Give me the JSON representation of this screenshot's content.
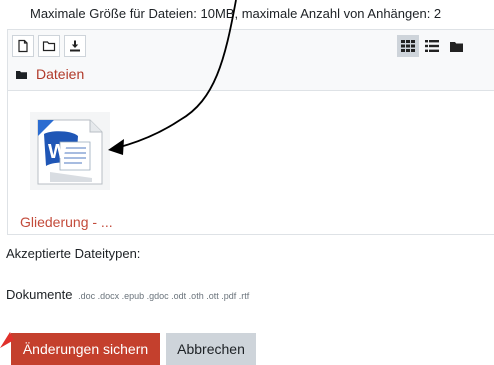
{
  "size_info": "Maximale Größe für Dateien: 10MB, maximale Anzahl von Anhängen: 2",
  "filemanager": {
    "toolbar": {
      "left_icons": [
        "add-file-icon",
        "create-folder-icon",
        "download-icon"
      ],
      "view_icons": [
        "grid-view-icon",
        "list-view-icon",
        "tree-view-icon"
      ],
      "active_view": "grid-view-icon"
    },
    "breadcrumb": {
      "folder": "Dateien"
    },
    "files": [
      {
        "name": "Gliederung - ...",
        "icon": "word-document-icon"
      }
    ]
  },
  "accepted": {
    "label": "Akzeptierte Dateitypen:",
    "category": "Dokumente",
    "extensions": ".doc .docx .epub .gdoc .odt .oth .ott .pdf .rtf"
  },
  "buttons": {
    "save": "Änderungen sichern",
    "cancel": "Abbrechen"
  },
  "colors": {
    "primary": "#c4402d",
    "link": "#b13a2a",
    "secondary": "#ced4da"
  }
}
